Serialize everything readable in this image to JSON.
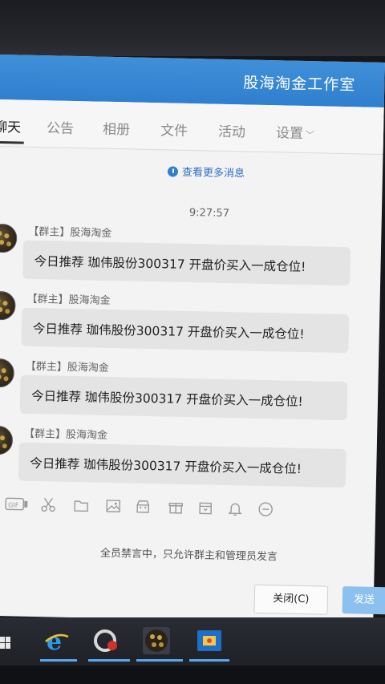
{
  "window": {
    "title": "股海淘金工作室"
  },
  "tabs": [
    {
      "label": "聊天"
    },
    {
      "label": "公告"
    },
    {
      "label": "相册"
    },
    {
      "label": "文件"
    },
    {
      "label": "活动"
    },
    {
      "label": "设置"
    }
  ],
  "chat": {
    "more_link": "查看更多消息",
    "timestamp": "9:27:57",
    "messages": [
      {
        "sender": "【群主】股海淘金",
        "text": "今日推荐  珈伟股份300317  开盘价买入一成仓位!"
      },
      {
        "sender": "【群主】股海淘金",
        "text": "今日推荐  珈伟股份300317  开盘价买入一成仓位!"
      },
      {
        "sender": "【群主】股海淘金",
        "text": "今日推荐  珈伟股份300317  开盘价买入一成仓位!"
      },
      {
        "sender": "【群主】股海淘金",
        "text": "今日推荐  珈伟股份300317  开盘价买入一成仓位!"
      }
    ]
  },
  "toolbar": {
    "icons": [
      "gif-icon",
      "scissors-icon",
      "folder-icon",
      "image-icon",
      "shop-icon",
      "gift-icon",
      "calendar-icon",
      "bell-icon",
      "more-icon"
    ],
    "gif_label": "GIF"
  },
  "composer": {
    "notice": "全员禁言中，只允许群主和管理员发言",
    "close_label": "关闭(C)",
    "send_label": "发送"
  },
  "colors": {
    "title_bar": "#2f7fcf",
    "accent": "#2f6fc4",
    "bubble": "#e4e4e4"
  }
}
